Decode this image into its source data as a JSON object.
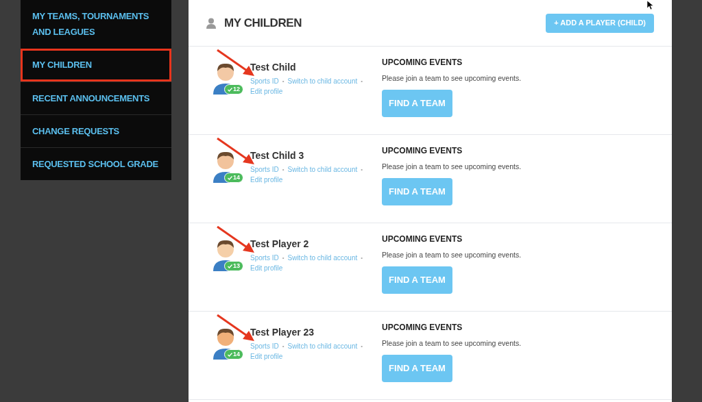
{
  "sidebar": {
    "items": [
      {
        "label": "MY TEAMS, TOURNAMENTS AND LEAGUES",
        "selected": false
      },
      {
        "label": "MY CHILDREN",
        "selected": true
      },
      {
        "label": "RECENT ANNOUNCEMENTS",
        "selected": false
      },
      {
        "label": "CHANGE REQUESTS",
        "selected": false
      },
      {
        "label": "REQUESTED SCHOOL GRADE",
        "selected": false
      }
    ]
  },
  "header": {
    "title": "MY CHILDREN",
    "add_button": "+ ADD A PLAYER (CHILD)"
  },
  "children": [
    {
      "name": "Test Child",
      "badge": "12",
      "links": [
        {
          "kind": "link",
          "text": "Sports ID"
        },
        {
          "kind": "separator",
          "text": "•"
        },
        {
          "kind": "link",
          "text": "Switch to child account"
        },
        {
          "kind": "separator",
          "text": "•"
        },
        {
          "kind": "link",
          "text": "Edit profile"
        }
      ],
      "events_title": "UPCOMING EVENTS",
      "events_message": "Please join a team to see upcoming events.",
      "button": "FIND A TEAM"
    },
    {
      "name": "Test Child 3",
      "badge": "14",
      "links": [
        {
          "kind": "link",
          "text": "Sports ID"
        },
        {
          "kind": "separator",
          "text": "•"
        },
        {
          "kind": "link",
          "text": "Switch to child account"
        },
        {
          "kind": "separator",
          "text": "•"
        },
        {
          "kind": "link",
          "text": "Edit profile"
        }
      ],
      "events_title": "UPCOMING EVENTS",
      "events_message": "Please join a team to see upcoming events.",
      "button": "FIND A TEAM"
    },
    {
      "name": "Test Player 2",
      "badge": "13",
      "links": [
        {
          "kind": "link",
          "text": "Sports ID"
        },
        {
          "kind": "separator",
          "text": "•"
        },
        {
          "kind": "link",
          "text": "Switch to child account"
        },
        {
          "kind": "separator",
          "text": "•"
        },
        {
          "kind": "link",
          "text": "Edit profile"
        }
      ],
      "events_title": "UPCOMING EVENTS",
      "events_message": "Please join a team to see upcoming events.",
      "button": "FIND A TEAM"
    },
    {
      "name": "Test Player 23",
      "badge": "14",
      "links": [
        {
          "kind": "link",
          "text": "Sports ID"
        },
        {
          "kind": "separator",
          "text": "•"
        },
        {
          "kind": "link",
          "text": "Switch to child account"
        },
        {
          "kind": "separator",
          "text": "•"
        },
        {
          "kind": "link",
          "text": "Edit profile"
        }
      ],
      "events_title": "UPCOMING EVENTS",
      "events_message": "Please join a team to see upcoming events.",
      "button": "FIND A TEAM"
    }
  ]
}
